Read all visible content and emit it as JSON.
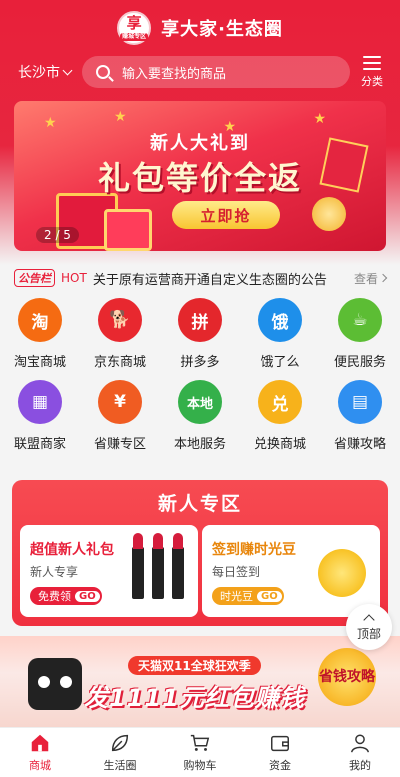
{
  "header": {
    "logo_text": "享",
    "logo_sub": "赚城专区",
    "title": "享大家·生态圈",
    "city": "长沙市",
    "search_placeholder": "输入要查找的商品",
    "category_label": "分类"
  },
  "banner": {
    "top_text": "新人大礼到",
    "main_text": "礼包等价全返",
    "button": "立即抢",
    "pager": "2 / 5"
  },
  "notice": {
    "tag": "公告栏",
    "hot": "HOT",
    "text": "关于原有运营商开通自定义生态圈的公告",
    "more": "查看"
  },
  "grid": [
    {
      "label": "淘宝商城",
      "glyph": "淘",
      "color": "#f56b12",
      "icon": "taobao-icon"
    },
    {
      "label": "京东商城",
      "glyph": "🐕",
      "color": "#e8282f",
      "icon": "jd-dog-icon"
    },
    {
      "label": "拼多多",
      "glyph": "拼",
      "color": "#e4272c",
      "icon": "pinduoduo-icon"
    },
    {
      "label": "饿了么",
      "glyph": "饿",
      "color": "#1e8fea",
      "icon": "eleme-icon"
    },
    {
      "label": "便民服务",
      "glyph": "☕",
      "color": "#5cbd34",
      "icon": "coffee-cup-icon"
    },
    {
      "label": "联盟商家",
      "glyph": "▦",
      "color": "#8a4fe0",
      "icon": "storefront-icon"
    },
    {
      "label": "省赚专区",
      "glyph": "¥",
      "color": "#f05c22",
      "icon": "money-bag-icon"
    },
    {
      "label": "本地服务",
      "glyph": "本地",
      "color": "#34b04a",
      "icon": "local-service-icon"
    },
    {
      "label": "兑换商城",
      "glyph": "兑",
      "color": "#f7b21b",
      "icon": "exchange-icon"
    },
    {
      "label": "省赚攻略",
      "glyph": "▤",
      "color": "#2f8ff0",
      "icon": "guide-book-icon"
    }
  ],
  "newzone": {
    "title": "新人专区",
    "cards": [
      {
        "title": "超值新人礼包",
        "sub": "新人专享",
        "pill": "免费领",
        "go": "GO",
        "title_color": "#e8203a",
        "pill_color": "#e8203a"
      },
      {
        "title": "签到赚时光豆",
        "sub": "每日签到",
        "pill": "时光豆",
        "go": "GO",
        "title_color": "#e8860c",
        "pill_color": "#f3a11a"
      }
    ]
  },
  "top_button": "顶部",
  "promo": {
    "sub": "天猫双11全球狂欢季",
    "main": "发1111元红包赚钱",
    "badge": "省钱攻略"
  },
  "tabs": [
    {
      "label": "商城",
      "icon": "home-icon"
    },
    {
      "label": "生活圈",
      "icon": "leaf-icon"
    },
    {
      "label": "购物车",
      "icon": "cart-icon"
    },
    {
      "label": "资金",
      "icon": "wallet-icon"
    },
    {
      "label": "我的",
      "icon": "user-icon"
    }
  ]
}
